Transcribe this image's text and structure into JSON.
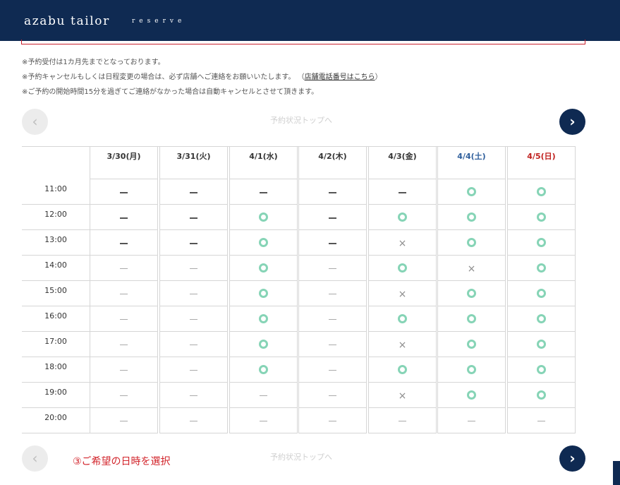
{
  "header": {
    "brand": "azabu tailor",
    "sub": "reserve",
    "background": "#0f2a52"
  },
  "notes": {
    "line1": "※予約受付は1カ月先までとなっております。",
    "line2": "※予約キャンセルもしくは日程変更の場合は、必ず店舗へご連絡をお願いいたします。",
    "line2_paren_open": "（",
    "line2_link": "店舗電話番号はこちら",
    "line2_paren_close": "）",
    "line3": "※ご予約の開始時間15分を過ぎてご連絡がなかった場合は自動キャンセルとさせて頂きます。"
  },
  "nav": {
    "prev_icon": "‹",
    "next_icon": "›",
    "top_link": "予約状況トップへ",
    "bottom_link": "予約状況トップへ",
    "annotation": "③ご希望の日時を選択"
  },
  "calendar": {
    "days": [
      {
        "label": "3/30(月)",
        "color": "#333333"
      },
      {
        "label": "3/31(火)",
        "color": "#333333"
      },
      {
        "label": "4/1(水)",
        "color": "#333333"
      },
      {
        "label": "4/2(木)",
        "color": "#333333"
      },
      {
        "label": "4/3(金)",
        "color": "#333333"
      },
      {
        "label": "4/4(土)",
        "color": "#2f5f9c"
      },
      {
        "label": "4/5(日)",
        "color": "#c0211f"
      }
    ],
    "times": [
      "11:00",
      "12:00",
      "13:00",
      "14:00",
      "15:00",
      "16:00",
      "17:00",
      "18:00",
      "19:00",
      "20:00"
    ],
    "status": [
      [
        "-",
        "-",
        "-",
        "-",
        "-",
        "o",
        "o"
      ],
      [
        "-",
        "-",
        "o",
        "-",
        "o",
        "o",
        "o"
      ],
      [
        "-",
        "-",
        "o",
        "-",
        "x",
        "o",
        "o"
      ],
      [
        "_",
        "_",
        "o",
        "_",
        "o",
        "x",
        "o"
      ],
      [
        "_",
        "_",
        "o",
        "_",
        "x",
        "o",
        "o"
      ],
      [
        "_",
        "_",
        "o",
        "_",
        "o",
        "o",
        "o"
      ],
      [
        "_",
        "_",
        "o",
        "_",
        "x",
        "o",
        "o"
      ],
      [
        "_",
        "_",
        "o",
        "_",
        "o",
        "o",
        "o"
      ],
      [
        "_",
        "_",
        "_",
        "_",
        "x",
        "o",
        "o"
      ],
      [
        "_",
        "_",
        "_",
        "_",
        "_",
        "_",
        "_"
      ]
    ]
  }
}
